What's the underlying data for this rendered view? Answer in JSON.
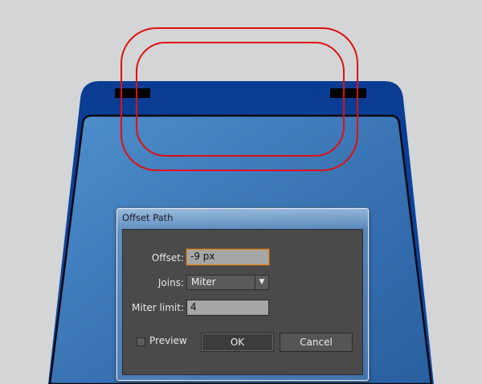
{
  "dialog": {
    "title": "Offset Path",
    "offset_label": "Offset:",
    "offset_value": "-9 px",
    "joins_label": "Joins:",
    "joins_value": "Miter",
    "miter_label": "Miter limit:",
    "miter_value": "4",
    "preview_label": "Preview",
    "preview_checked": false,
    "ok_label": "OK",
    "cancel_label": "Cancel"
  },
  "colors": {
    "background": "#d4d5d6",
    "shape_blue": "#3b78b8",
    "shape_dark": "#0b3a86",
    "offset_path": "#e01010",
    "dialog_body": "#4a4a4a",
    "focus_ring": "#e08a2c"
  }
}
